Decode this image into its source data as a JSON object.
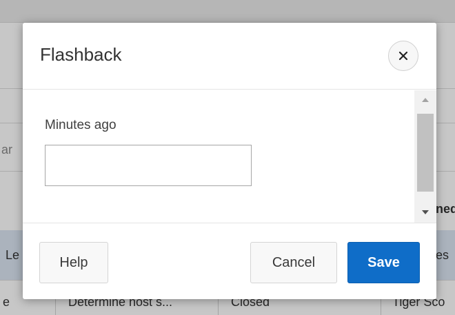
{
  "background": {
    "left_fragments": [
      "ar",
      "Le",
      "e"
    ],
    "row_cells": [
      "Determine host s...",
      "Closed",
      "Tiger Sco"
    ],
    "right_fragments": [
      "ned",
      "es"
    ]
  },
  "dialog": {
    "title": "Flashback",
    "close_icon": "close-icon",
    "field": {
      "label": "Minutes ago",
      "value": "",
      "placeholder": ""
    },
    "buttons": {
      "help": "Help",
      "cancel": "Cancel",
      "save": "Save"
    }
  },
  "colors": {
    "save_button": "#0f6dc8",
    "overlay": "rgba(0,0,0,0.22)"
  }
}
